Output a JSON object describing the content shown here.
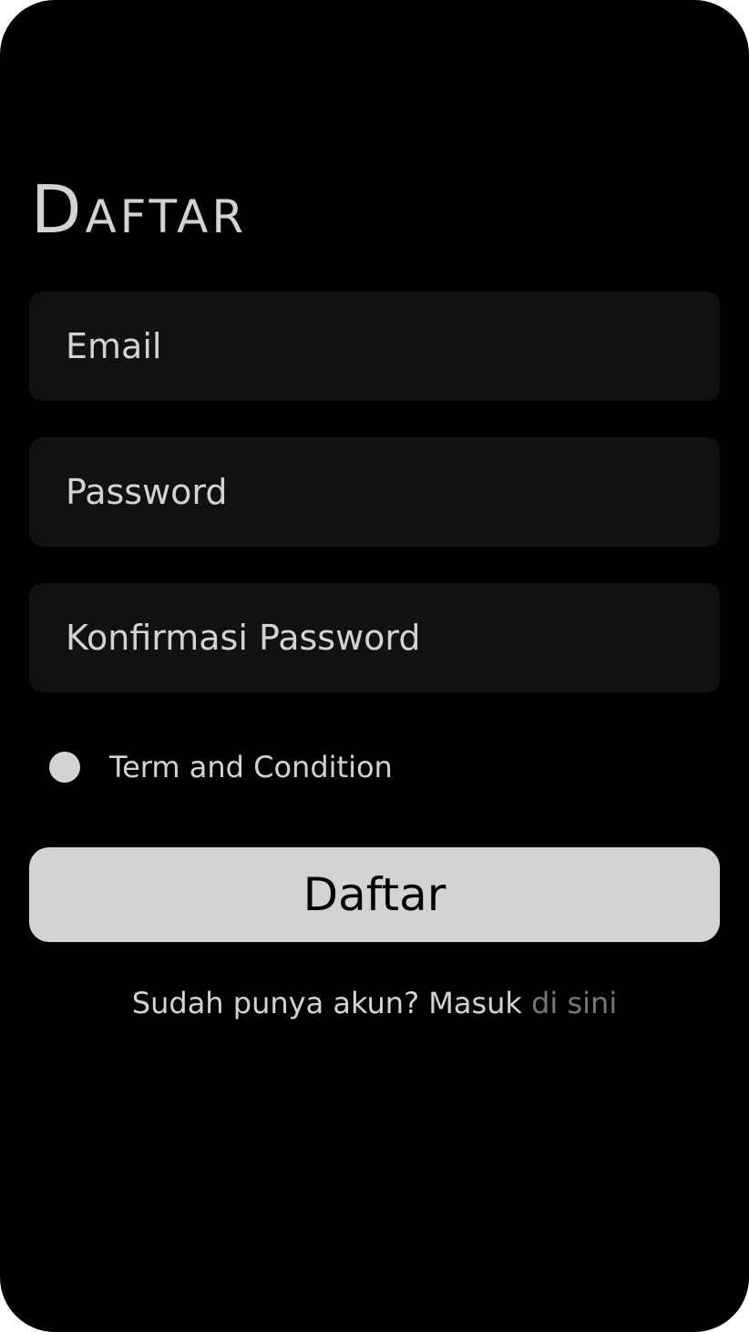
{
  "page": {
    "title": "Daftar"
  },
  "form": {
    "email_placeholder": "Email",
    "password_placeholder": "Password",
    "confirm_password_placeholder": "Konfirmasi Password",
    "terms_label": "Term and Condition",
    "terms_checked": true,
    "submit_label": "Daftar"
  },
  "footer": {
    "prompt": "Sudah punya akun? Masuk",
    "link_label": "di sini"
  },
  "colors": {
    "background": "#000000",
    "field_background": "#111111",
    "text": "#d3d3d3",
    "button_background": "#d3d3d3",
    "button_text": "#000000",
    "link": "#777777"
  }
}
